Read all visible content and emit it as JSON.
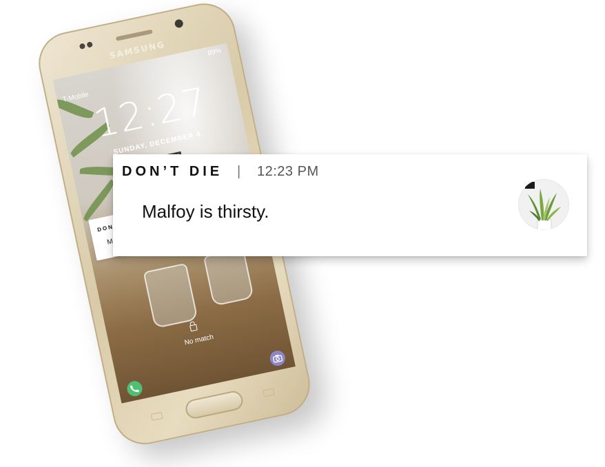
{
  "phone": {
    "brand": "SAMSUNG",
    "status": "89%",
    "carrier": "T-Mobile",
    "clock": "12:27",
    "date": "SUNDAY, DECEMBER 4",
    "mini_notification": {
      "app": "DON'T DIE",
      "message": "Malfoy is t"
    },
    "unlock_text": "No match"
  },
  "notification": {
    "app_name": "DON’T DIE",
    "separator": "|",
    "time": "12:23  PM",
    "message": "Malfoy is thirsty.",
    "avatar_icon": "plant-icon"
  },
  "colors": {
    "phone_body": "#d9cba8",
    "call_button": "#4fbf74",
    "camera_button": "#8e86c7",
    "plant_leaf": "#6e9a3f"
  }
}
